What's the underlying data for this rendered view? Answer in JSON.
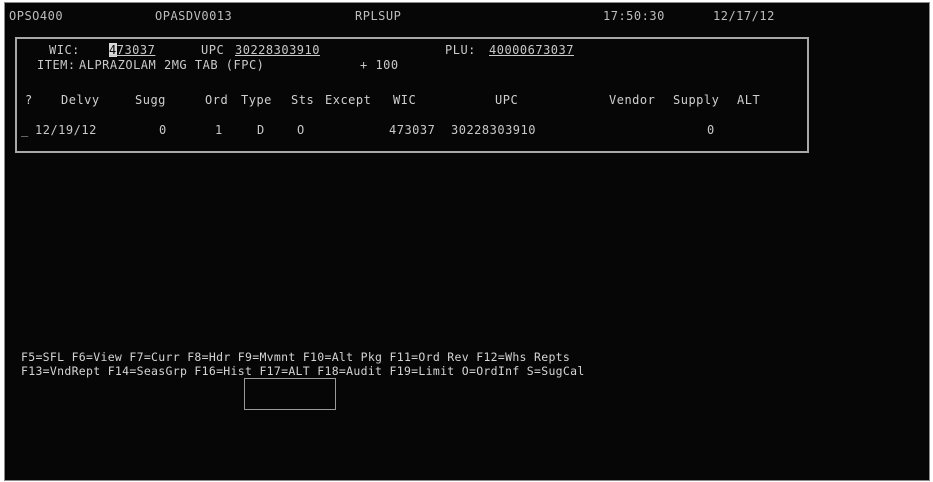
{
  "header": {
    "program": "OPSO400",
    "screen_id": "OPASDV0013",
    "module": "RPLSUP",
    "time": "17:50:30",
    "date": "12/17/12"
  },
  "item": {
    "wic_label": "WIC:",
    "wic_cursor": "4",
    "wic_rest": "73037",
    "upc_label": "UPC",
    "upc_value": "30228303910",
    "plu_label": "PLU:",
    "plu_value": "40000673037",
    "item_label": "ITEM:",
    "item_desc": "ALPRAZOLAM 2MG TAB (FPC)",
    "pack": "+ 100"
  },
  "columns": {
    "opt": "?",
    "delvy": "Delvy",
    "sugg": "Sugg",
    "ord": "Ord",
    "type": "Type",
    "sts": "Sts",
    "except": "Except",
    "wic": "WIC",
    "upc": "UPC",
    "vendor": "Vendor",
    "supply": "Supply",
    "alt": "ALT"
  },
  "rows": [
    {
      "opt": "_",
      "delvy": "12/19/12",
      "sugg": "0",
      "ord": "1",
      "type": "D",
      "sts": "O",
      "wic": "473037",
      "upc": "30228303910",
      "supply": "0"
    }
  ],
  "function_keys": {
    "f5": "F5=SFL",
    "f6": "F6=View",
    "f7": "F7=Curr",
    "f8": "F8=Hdr",
    "f9": "F9=Mvmnt",
    "f10": "F10=Alt Pkg",
    "f11": "F11=Ord Rev",
    "f12": "F12=Whs Repts",
    "f13": "F13=VndRept",
    "f14": "F14=SeasGrp",
    "f16": "F16=Hist",
    "f17": "F17=ALT",
    "f18": "F18=Audit",
    "f19": "F19=Limit",
    "o_ordinf": "O=OrdInf",
    "s_sugcal": "S=SugCal"
  }
}
